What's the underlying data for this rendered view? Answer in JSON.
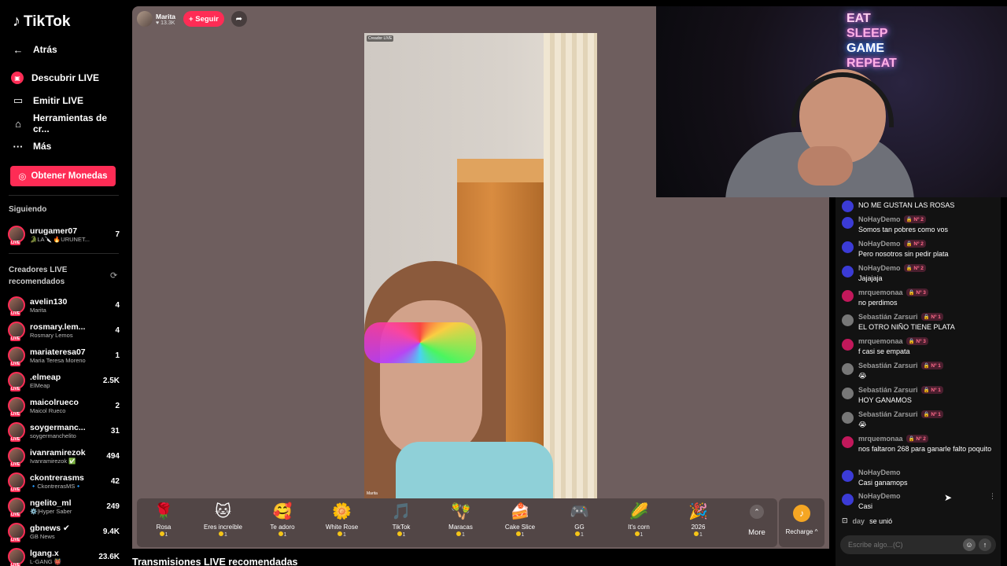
{
  "brand": {
    "name": "TikTok"
  },
  "nav": {
    "back": "Atrás",
    "items": [
      {
        "label": "Descubrir LIVE",
        "icon": "live-discover-icon"
      },
      {
        "label": "Emitir LIVE",
        "icon": "video-camera-icon"
      },
      {
        "label": "Herramientas de cr...",
        "icon": "creator-tools-icon"
      },
      {
        "label": "Más",
        "icon": "more-dots-icon"
      }
    ],
    "coins_button": "Obtener Monedas"
  },
  "following": {
    "label": "Siguiendo",
    "items": [
      {
        "name": "urugamer07",
        "sub": "🐊LA🔪 🔥URUNET...",
        "count": "7"
      }
    ]
  },
  "recommended": {
    "label": "Creadores LIVE recomendados",
    "items": [
      {
        "name": "avelin130",
        "sub": "Marita",
        "count": "4"
      },
      {
        "name": "rosmary.lem...",
        "sub": "Rosmary Lemos",
        "count": "4"
      },
      {
        "name": "mariateresa07",
        "sub": "Maria Teresa Moreno",
        "count": "1"
      },
      {
        "name": ".elmeap",
        "sub": "ElMeap",
        "count": "2.5K"
      },
      {
        "name": "maicolrueco",
        "sub": "Maicol Rueco",
        "count": "2"
      },
      {
        "name": "soygermanc...",
        "sub": "soygermanchelito",
        "count": "31"
      },
      {
        "name": "ivanramirezok",
        "sub": "Ivanramirezok ✅",
        "count": "494"
      },
      {
        "name": "ckontrerasms",
        "sub": "🔹CkontrerasMS🔹",
        "count": "42"
      },
      {
        "name": "ngelito_ml",
        "sub": "⚙️|Hyper Saber",
        "count": "249"
      },
      {
        "name": "gbnews ✔",
        "sub": "GB News",
        "count": "9.4K"
      },
      {
        "name": "lgang.x",
        "sub": "L-GANG 👹",
        "count": "23.6K"
      }
    ]
  },
  "stream": {
    "host_name": "Marita",
    "host_likes": "13.3K",
    "follow_label": "+ Seguir",
    "watermark": "Creador LIVE",
    "watermark_name": "Marita"
  },
  "gifts": [
    {
      "name": "Rosa",
      "price": "1",
      "icon": "🌹"
    },
    {
      "name": "Eres increíble",
      "price": "1",
      "icon": "🐱"
    },
    {
      "name": "Te adoro",
      "price": "1",
      "icon": "🥰"
    },
    {
      "name": "White Rose",
      "price": "1",
      "icon": "🌼"
    },
    {
      "name": "TikTok",
      "price": "1",
      "icon": "🎵"
    },
    {
      "name": "Maracas",
      "price": "1",
      "icon": "🪇"
    },
    {
      "name": "Cake Slice",
      "price": "1",
      "icon": "🍰"
    },
    {
      "name": "GG",
      "price": "1",
      "icon": "🎮"
    },
    {
      "name": "It's corn",
      "price": "1",
      "icon": "🌽"
    },
    {
      "name": "2026",
      "price": "1",
      "icon": "🎉"
    }
  ],
  "gift_more": "More",
  "recharge": "Recharge ^",
  "recommended_streams_heading": "Transmisiones LIVE recomendadas",
  "neon_sign": [
    "EAT",
    "SLEEP",
    "GAME",
    "REPEAT"
  ],
  "chat": {
    "messages": [
      {
        "user": "",
        "badge": "",
        "text": "NO ME GUSTAN LAS ROSAS",
        "color": "#3b3bd6"
      },
      {
        "user": "NoHayDemo",
        "badge": "🔒 Nº 2",
        "text": "Somos tan pobres como vos",
        "color": "#3b3bd6"
      },
      {
        "user": "NoHayDemo",
        "badge": "🔒 Nº 2",
        "text": "Pero nosotros sin pedir plata",
        "color": "#3b3bd6"
      },
      {
        "user": "NoHayDemo",
        "badge": "🔒 Nº 2",
        "text": "Jajajaja",
        "color": "#3b3bd6"
      },
      {
        "user": "mrquemonaa",
        "badge": "🔒 Nº 3",
        "text": "no perdimos",
        "color": "#c2185b"
      },
      {
        "user": "Sebastián Zarsuri",
        "badge": "🔒 Nº 1",
        "text": "EL OTRO NIÑO TIENE PLATA",
        "color": "#777777"
      },
      {
        "user": "mrquemonaa",
        "badge": "🔒 Nº 3",
        "text": "f casi se empata",
        "color": "#c2185b"
      },
      {
        "user": "Sebastián Zarsuri",
        "badge": "🔒 Nº 1",
        "text": "😭",
        "color": "#777777"
      },
      {
        "user": "Sebastián Zarsuri",
        "badge": "🔒 Nº 1",
        "text": "HOY GANAMOS",
        "color": "#777777"
      },
      {
        "user": "Sebastián Zarsuri",
        "badge": "🔒 Nº 1",
        "text": "😭",
        "color": "#777777"
      },
      {
        "user": "mrquemonaa",
        "badge": "🔒 Nº 2",
        "text": "nos faltaron 268 para ganarle falto poquito",
        "color": "#c2185b"
      },
      {
        "user": "NoHayDemo",
        "badge": "",
        "text": "Casi ganamops",
        "color": "#3b3bd6"
      },
      {
        "user": "NoHayDemo",
        "badge": "",
        "text": "Casi",
        "color": "#3b3bd6"
      }
    ],
    "joined_user": "day",
    "joined_text": "se unió",
    "input_placeholder": "Escribe algo...(C)"
  }
}
